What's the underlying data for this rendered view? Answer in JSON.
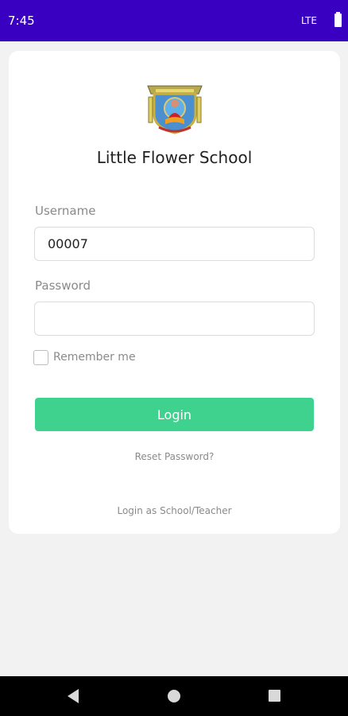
{
  "status_bar": {
    "time": "7:45",
    "network": "LTE",
    "battery_icon": "battery-full-icon"
  },
  "login_card": {
    "logo_icon": "school-crest-logo",
    "school_name": "Little Flower School",
    "username": {
      "label": "Username",
      "value": "00007"
    },
    "password": {
      "label": "Password",
      "value": ""
    },
    "remember_me": {
      "label": "Remember me",
      "checked": false
    },
    "login_button": "Login",
    "reset_password": "Reset Password?",
    "login_as": "Login as School/Teacher"
  },
  "colors": {
    "status_bar": "#3a00c2",
    "login_button": "#3fd28f",
    "background": "#f2f2f2"
  },
  "nav_bar": {
    "icons": [
      "back-icon",
      "home-icon",
      "recent-apps-icon"
    ]
  }
}
